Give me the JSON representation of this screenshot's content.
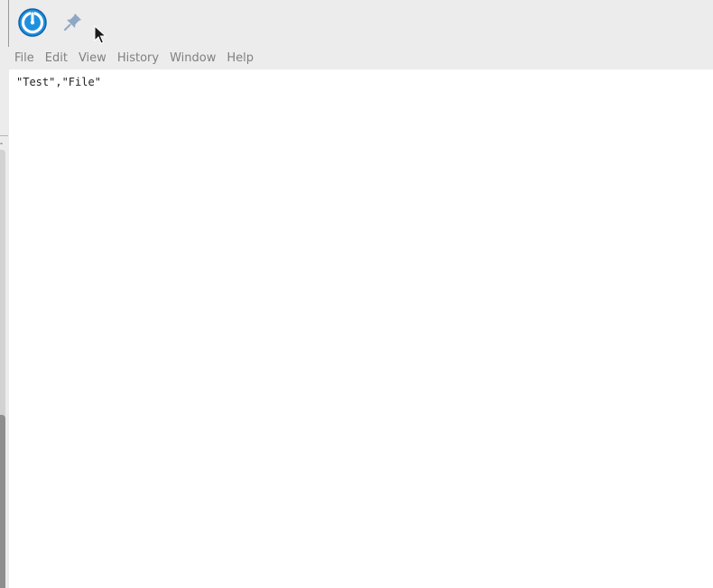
{
  "toolbar": {
    "app_icon": "app-logo-icon",
    "pin_icon": "pin-icon",
    "cursor_icon": "mouse-pointer-icon",
    "accent_color": "#1e90e0"
  },
  "menu": {
    "items": [
      {
        "label": "File"
      },
      {
        "label": "Edit"
      },
      {
        "label": "View"
      },
      {
        "label": "History"
      },
      {
        "label": "Window"
      },
      {
        "label": "Help"
      }
    ]
  },
  "editor": {
    "content": "\"Test\",\"File\""
  }
}
